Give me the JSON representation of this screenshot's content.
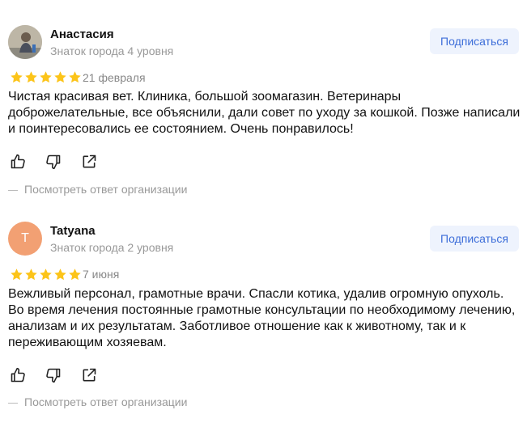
{
  "reviews": [
    {
      "author": "Анастасия",
      "level": "Знаток города 4 уровня",
      "subscribe_label": "Подписаться",
      "rating": 5,
      "date": "21 февраля",
      "text": "Чистая красивая вет. Клиника, большой зоомагазин. Ветеринары доброжелательные, все объяснили, дали совет по уходу за кошкой. Позже написали и поинтересовались ее состоянием. Очень понравилось!",
      "reply_link": "Посмотреть ответ организации"
    },
    {
      "author": "Tatyana",
      "avatar_letter": "T",
      "level": "Знаток города 2 уровня",
      "subscribe_label": "Подписаться",
      "rating": 5,
      "date": "7 июня",
      "text": "Вежливый персонал, грамотные врачи. Спасли котика, удалив огромную опухоль. Во время лечения постоянные грамотные консультации по необходимому лечению, анализам и их результатам. Заботливое отношение как к животному, так и к переживающим хозяевам.",
      "reply_link": "Посмотреть ответ организации"
    }
  ],
  "colors": {
    "star": "#fcc419",
    "accent": "#3d6ed9",
    "subscribe_bg": "#eef3fd",
    "avatar_letter_bg": "#f2a073"
  }
}
